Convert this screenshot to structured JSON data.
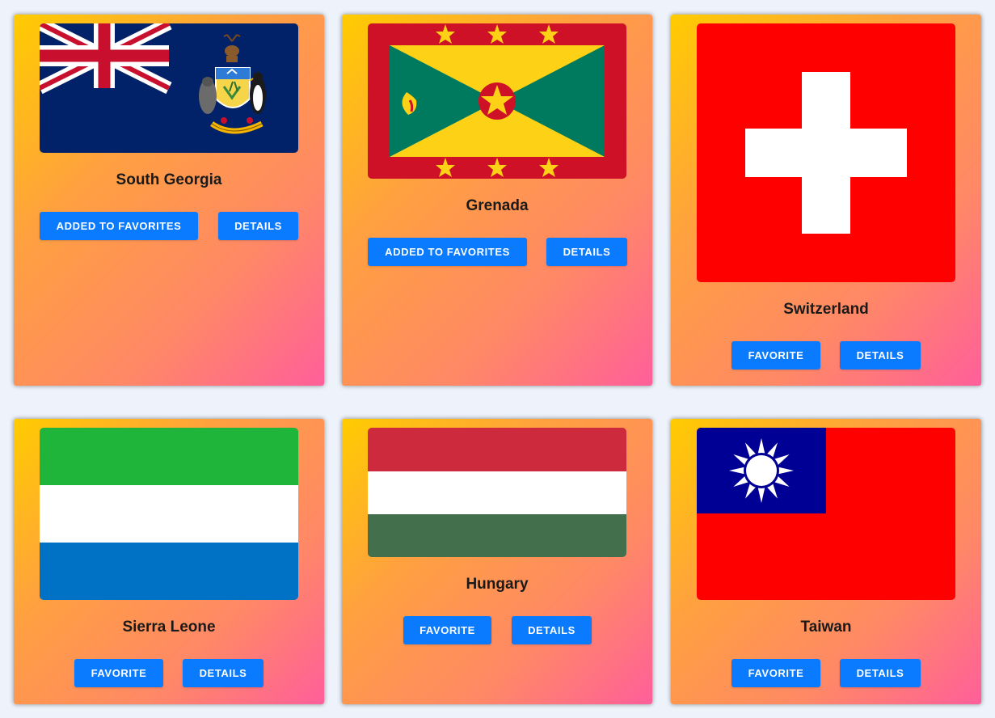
{
  "countries": [
    {
      "name": "South Georgia",
      "favorite_label": "ADDED TO FAVORITES",
      "details_label": "DETAILS"
    },
    {
      "name": "Grenada",
      "favorite_label": "ADDED TO FAVORITES",
      "details_label": "DETAILS"
    },
    {
      "name": "Switzerland",
      "favorite_label": "FAVORITE",
      "details_label": "DETAILS"
    },
    {
      "name": "Sierra Leone",
      "favorite_label": "FAVORITE",
      "details_label": "DETAILS"
    },
    {
      "name": "Hungary",
      "favorite_label": "FAVORITE",
      "details_label": "DETAILS"
    },
    {
      "name": "Taiwan",
      "favorite_label": "FAVORITE",
      "details_label": "DETAILS"
    }
  ],
  "colors": {
    "button": "#0a7bff",
    "card_gradient_start": "#ffcc00",
    "card_gradient_end": "#ff5f9a"
  }
}
